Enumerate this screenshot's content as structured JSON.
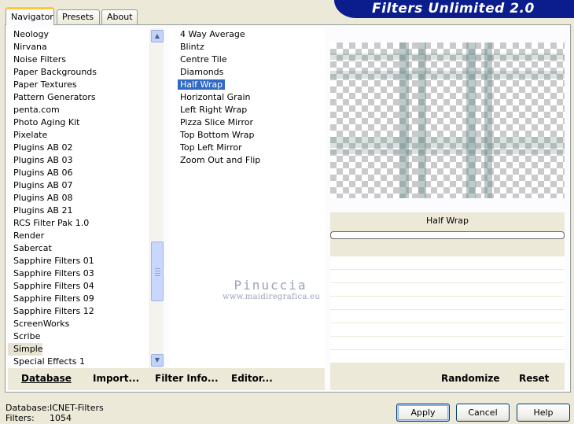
{
  "app": {
    "title": "Filters Unlimited 2.0"
  },
  "tabs": [
    {
      "label": "Navigator",
      "active": true
    },
    {
      "label": "Presets",
      "active": false
    },
    {
      "label": "About",
      "active": false
    }
  ],
  "categories": {
    "items": [
      "Neology",
      "Nirvana",
      "Noise Filters",
      "Paper Backgrounds",
      "Paper Textures",
      "Pattern Generators",
      "penta.com",
      "Photo Aging Kit",
      "Pixelate",
      "Plugins AB 02",
      "Plugins AB 03",
      "Plugins AB 06",
      "Plugins AB 07",
      "Plugins AB 08",
      "Plugins AB 21",
      "RCS Filter Pak 1.0",
      "Render",
      "Sabercat",
      "Sapphire Filters 01",
      "Sapphire Filters 03",
      "Sapphire Filters 04",
      "Sapphire Filters 09",
      "Sapphire Filters 12",
      "ScreenWorks",
      "Scribe",
      "Simple",
      "Special Effects 1"
    ],
    "selected": "Simple"
  },
  "filters": {
    "items": [
      "4 Way Average",
      "Blintz",
      "Centre Tile",
      "Diamonds",
      "Half Wrap",
      "Horizontal Grain",
      "Left Right Wrap",
      "Pizza Slice Mirror",
      "Top Bottom Wrap",
      "Top Left Mirror",
      "Zoom Out and Flip"
    ],
    "selected": "Half Wrap"
  },
  "preview": {
    "filter_name": "Half Wrap"
  },
  "toolbar": {
    "database_label": "Database",
    "import_label": "Import...",
    "filter_info_label": "Filter Info...",
    "editor_label": "Editor...",
    "randomize_label": "Randomize",
    "reset_label": "Reset"
  },
  "status": {
    "database_label": "Database:",
    "database_value": "ICNET-Filters",
    "filters_label": "Filters:",
    "filters_value": "1054"
  },
  "dialog": {
    "apply_label": "Apply",
    "cancel_label": "Cancel",
    "help_label": "Help"
  },
  "watermark": {
    "name": "Pinuccia",
    "url": "www.maidiregrafica.eu"
  },
  "colors": {
    "banner": "#0b1c8c",
    "selection": "#316ac5",
    "window_bg": "#ece9d8"
  }
}
